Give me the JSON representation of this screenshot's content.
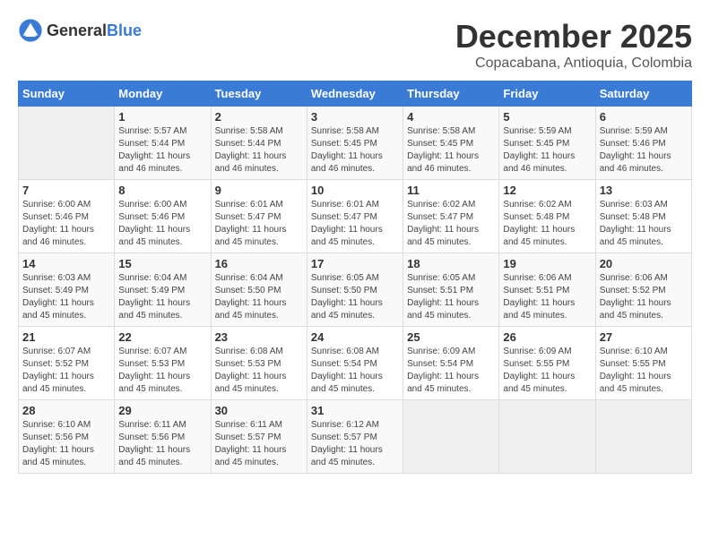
{
  "header": {
    "logo_general": "General",
    "logo_blue": "Blue",
    "title": "December 2025",
    "subtitle": "Copacabana, Antioquia, Colombia"
  },
  "weekdays": [
    "Sunday",
    "Monday",
    "Tuesday",
    "Wednesday",
    "Thursday",
    "Friday",
    "Saturday"
  ],
  "weeks": [
    [
      {
        "day": "",
        "info": ""
      },
      {
        "day": "1",
        "info": "Sunrise: 5:57 AM\nSunset: 5:44 PM\nDaylight: 11 hours and 46 minutes."
      },
      {
        "day": "2",
        "info": "Sunrise: 5:58 AM\nSunset: 5:44 PM\nDaylight: 11 hours and 46 minutes."
      },
      {
        "day": "3",
        "info": "Sunrise: 5:58 AM\nSunset: 5:45 PM\nDaylight: 11 hours and 46 minutes."
      },
      {
        "day": "4",
        "info": "Sunrise: 5:58 AM\nSunset: 5:45 PM\nDaylight: 11 hours and 46 minutes."
      },
      {
        "day": "5",
        "info": "Sunrise: 5:59 AM\nSunset: 5:45 PM\nDaylight: 11 hours and 46 minutes."
      },
      {
        "day": "6",
        "info": "Sunrise: 5:59 AM\nSunset: 5:46 PM\nDaylight: 11 hours and 46 minutes."
      }
    ],
    [
      {
        "day": "7",
        "info": "Sunrise: 6:00 AM\nSunset: 5:46 PM\nDaylight: 11 hours and 46 minutes."
      },
      {
        "day": "8",
        "info": "Sunrise: 6:00 AM\nSunset: 5:46 PM\nDaylight: 11 hours and 45 minutes."
      },
      {
        "day": "9",
        "info": "Sunrise: 6:01 AM\nSunset: 5:47 PM\nDaylight: 11 hours and 45 minutes."
      },
      {
        "day": "10",
        "info": "Sunrise: 6:01 AM\nSunset: 5:47 PM\nDaylight: 11 hours and 45 minutes."
      },
      {
        "day": "11",
        "info": "Sunrise: 6:02 AM\nSunset: 5:47 PM\nDaylight: 11 hours and 45 minutes."
      },
      {
        "day": "12",
        "info": "Sunrise: 6:02 AM\nSunset: 5:48 PM\nDaylight: 11 hours and 45 minutes."
      },
      {
        "day": "13",
        "info": "Sunrise: 6:03 AM\nSunset: 5:48 PM\nDaylight: 11 hours and 45 minutes."
      }
    ],
    [
      {
        "day": "14",
        "info": "Sunrise: 6:03 AM\nSunset: 5:49 PM\nDaylight: 11 hours and 45 minutes."
      },
      {
        "day": "15",
        "info": "Sunrise: 6:04 AM\nSunset: 5:49 PM\nDaylight: 11 hours and 45 minutes."
      },
      {
        "day": "16",
        "info": "Sunrise: 6:04 AM\nSunset: 5:50 PM\nDaylight: 11 hours and 45 minutes."
      },
      {
        "day": "17",
        "info": "Sunrise: 6:05 AM\nSunset: 5:50 PM\nDaylight: 11 hours and 45 minutes."
      },
      {
        "day": "18",
        "info": "Sunrise: 6:05 AM\nSunset: 5:51 PM\nDaylight: 11 hours and 45 minutes."
      },
      {
        "day": "19",
        "info": "Sunrise: 6:06 AM\nSunset: 5:51 PM\nDaylight: 11 hours and 45 minutes."
      },
      {
        "day": "20",
        "info": "Sunrise: 6:06 AM\nSunset: 5:52 PM\nDaylight: 11 hours and 45 minutes."
      }
    ],
    [
      {
        "day": "21",
        "info": "Sunrise: 6:07 AM\nSunset: 5:52 PM\nDaylight: 11 hours and 45 minutes."
      },
      {
        "day": "22",
        "info": "Sunrise: 6:07 AM\nSunset: 5:53 PM\nDaylight: 11 hours and 45 minutes."
      },
      {
        "day": "23",
        "info": "Sunrise: 6:08 AM\nSunset: 5:53 PM\nDaylight: 11 hours and 45 minutes."
      },
      {
        "day": "24",
        "info": "Sunrise: 6:08 AM\nSunset: 5:54 PM\nDaylight: 11 hours and 45 minutes."
      },
      {
        "day": "25",
        "info": "Sunrise: 6:09 AM\nSunset: 5:54 PM\nDaylight: 11 hours and 45 minutes."
      },
      {
        "day": "26",
        "info": "Sunrise: 6:09 AM\nSunset: 5:55 PM\nDaylight: 11 hours and 45 minutes."
      },
      {
        "day": "27",
        "info": "Sunrise: 6:10 AM\nSunset: 5:55 PM\nDaylight: 11 hours and 45 minutes."
      }
    ],
    [
      {
        "day": "28",
        "info": "Sunrise: 6:10 AM\nSunset: 5:56 PM\nDaylight: 11 hours and 45 minutes."
      },
      {
        "day": "29",
        "info": "Sunrise: 6:11 AM\nSunset: 5:56 PM\nDaylight: 11 hours and 45 minutes."
      },
      {
        "day": "30",
        "info": "Sunrise: 6:11 AM\nSunset: 5:57 PM\nDaylight: 11 hours and 45 minutes."
      },
      {
        "day": "31",
        "info": "Sunrise: 6:12 AM\nSunset: 5:57 PM\nDaylight: 11 hours and 45 minutes."
      },
      {
        "day": "",
        "info": ""
      },
      {
        "day": "",
        "info": ""
      },
      {
        "day": "",
        "info": ""
      }
    ]
  ]
}
